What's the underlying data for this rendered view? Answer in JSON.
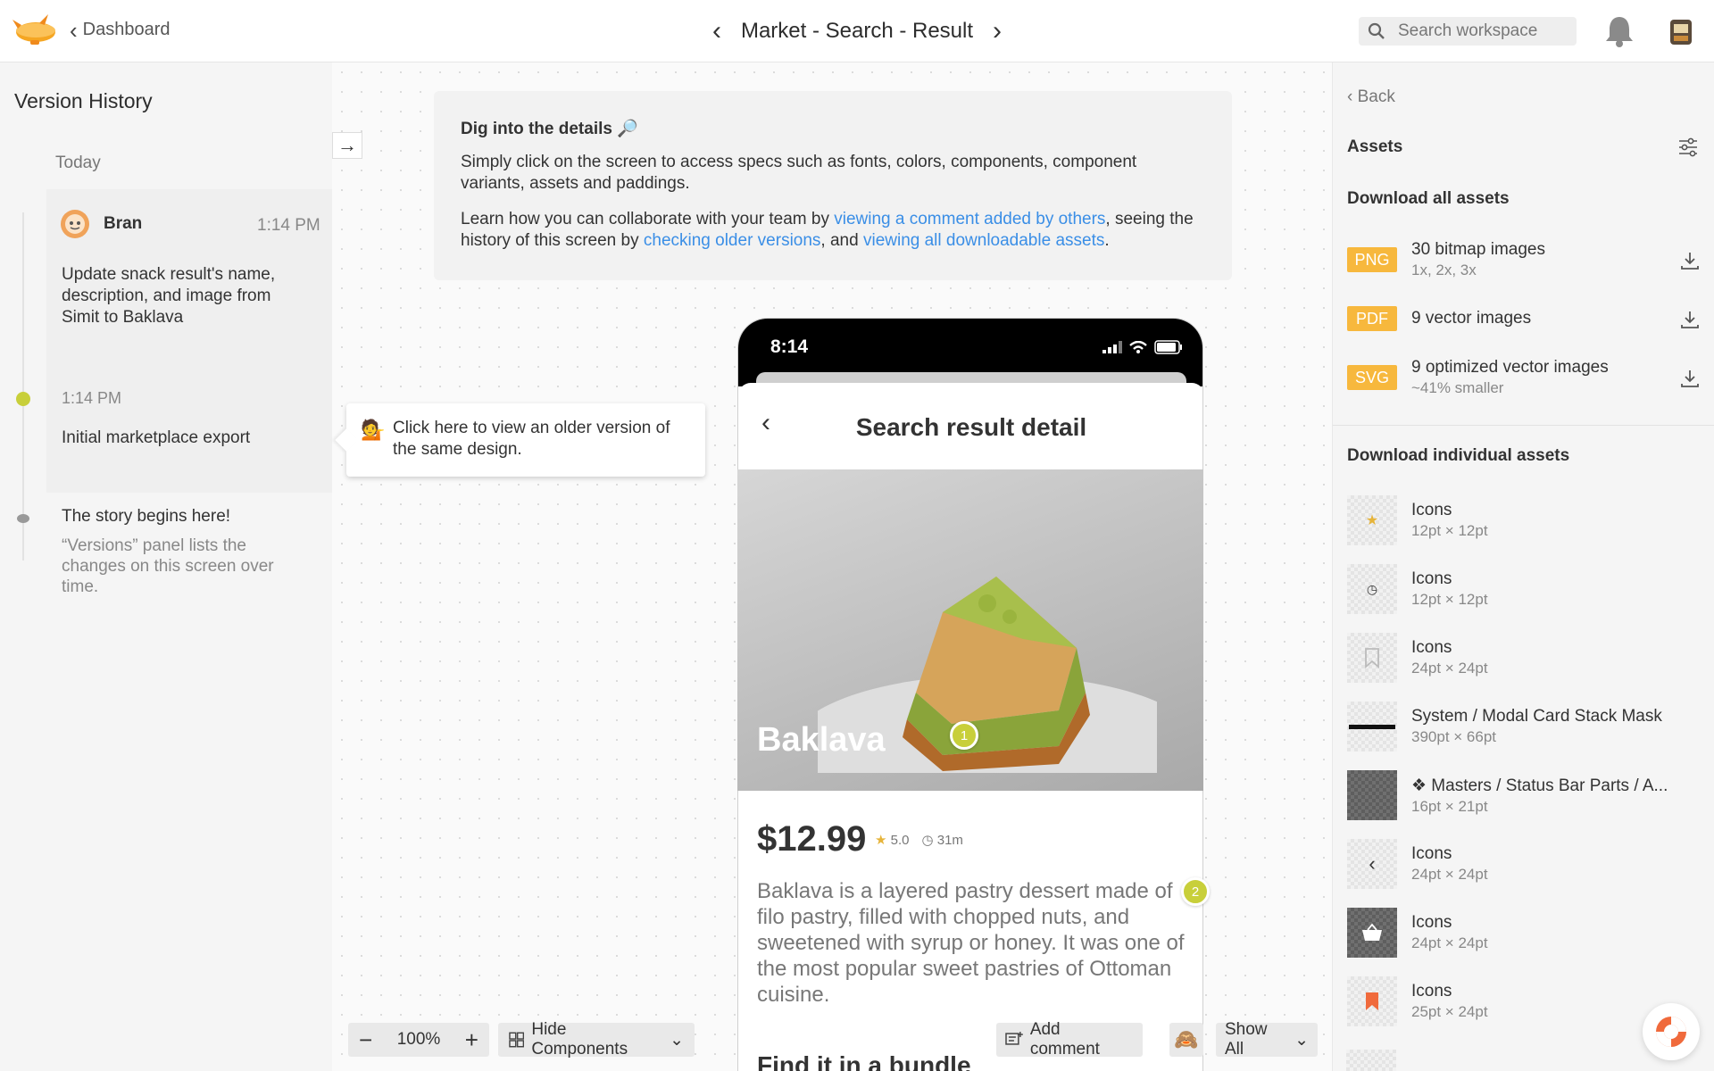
{
  "header": {
    "back_label": "Dashboard",
    "screen_title": "Market - Search - Result",
    "search_placeholder": "Search workspace"
  },
  "versions": {
    "heading": "Version History",
    "group_label": "Today",
    "items": [
      {
        "author": "Bran",
        "time": "1:14 PM",
        "description": "Update snack result's name, description, and image from Simit to Baklava"
      },
      {
        "time": "1:14 PM",
        "description": "Initial marketplace export"
      }
    ],
    "story": {
      "title": "The story begins here!",
      "description": "“Versions” panel lists the changes on this screen over time."
    }
  },
  "info_card": {
    "title": "Dig into the details 🔎",
    "paragraph1": "Simply click on the screen to access specs such as fonts, colors, components, component variants, assets and paddings.",
    "p2_part1": "Learn how you can collaborate with your team by ",
    "p2_link1": "viewing a comment added by others",
    "p2_part2": ", seeing the history of this screen by ",
    "p2_link2": "checking older versions",
    "p2_part3": ", and ",
    "p2_link3": "viewing all downloadable assets",
    "p2_part4": "."
  },
  "tooltip": {
    "emoji": "💁",
    "text": "Click here to view an older version of the same design."
  },
  "phone": {
    "clock": "8:14",
    "screen_title": "Search result detail",
    "product_name": "Baklava",
    "price": "$12.99",
    "rating": "5.0",
    "duration": "31m",
    "description": "Baklava is a layered pastry dessert made of filo pastry, filled with chopped nuts, and sweetened with syrup or honey. It was one of the most popular sweet pastries of Ottoman cuisine.",
    "section_title": "Find it in a bundle",
    "pins": [
      "1",
      "2"
    ]
  },
  "toolbar": {
    "zoom": "100%",
    "hide_components": "Hide Components",
    "add_comment": "Add comment",
    "show_all": "Show All"
  },
  "assets": {
    "back_label": "Back",
    "heading": "Assets",
    "download_all": "Download all assets",
    "formats": [
      {
        "badge": "PNG",
        "title": "30 bitmap images",
        "sub": "1x, 2x, 3x"
      },
      {
        "badge": "PDF",
        "title": "9 vector images",
        "sub": ""
      },
      {
        "badge": "SVG",
        "title": "9 optimized vector images",
        "sub": "~41% smaller"
      }
    ],
    "individual_heading": "Download individual assets",
    "items": [
      {
        "name": "Icons",
        "size": "12pt × 12pt",
        "icon": "star-icon"
      },
      {
        "name": "Icons",
        "size": "12pt × 12pt",
        "icon": "clock-icon"
      },
      {
        "name": "Icons",
        "size": "24pt × 24pt",
        "icon": "bookmark-icon"
      },
      {
        "name": "System / Modal Card Stack Mask",
        "size": "390pt × 66pt",
        "icon": "mask-bar"
      },
      {
        "name": "❖ Masters / Status Bar Parts / A...",
        "size": "16pt × 21pt",
        "icon": "dark-swatch"
      },
      {
        "name": "Icons",
        "size": "24pt × 24pt",
        "icon": "chevron-left-icon"
      },
      {
        "name": "Icons",
        "size": "24pt × 24pt",
        "icon": "basket-icon"
      },
      {
        "name": "Icons",
        "size": "25pt × 24pt",
        "icon": "bookmark-filled-icon"
      }
    ]
  },
  "colors": {
    "accent": "#c8cf3a",
    "link": "#3a8ee6",
    "badge": "#f7b83d",
    "bookmark": "#f06a3c"
  }
}
